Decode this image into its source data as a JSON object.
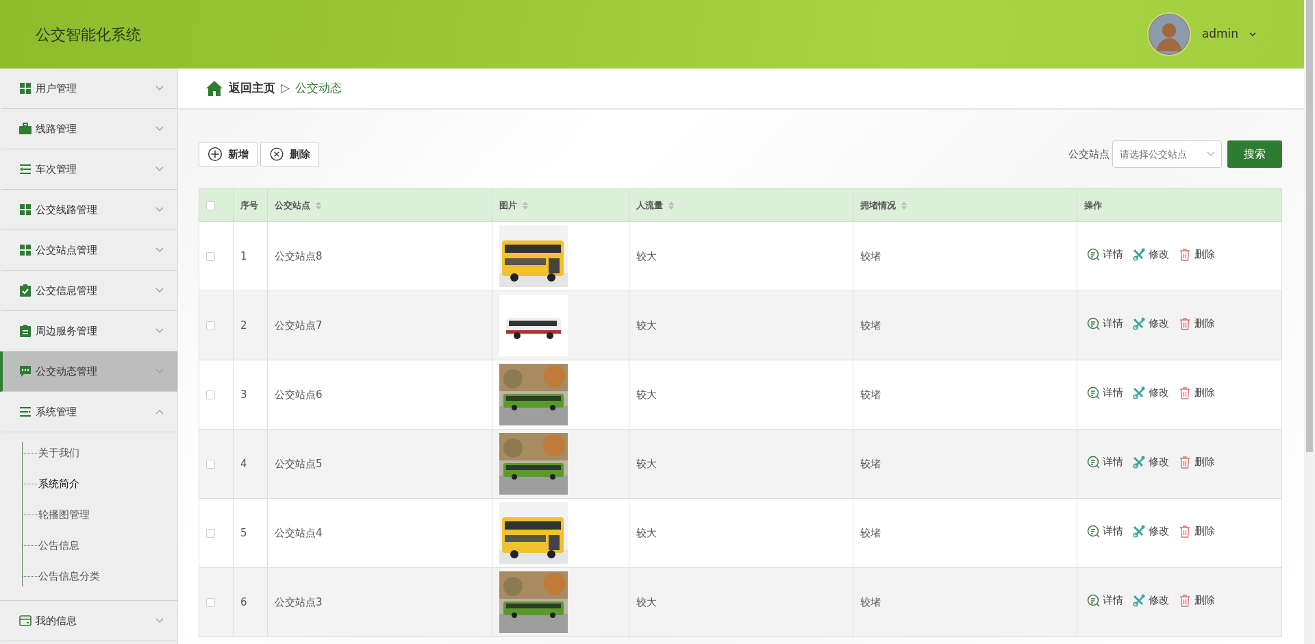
{
  "app_title": "公交智能化系统",
  "user": {
    "name": "admin"
  },
  "sidebar": {
    "items": [
      {
        "label": "用户管理",
        "selected": false,
        "expanded": false
      },
      {
        "label": "线路管理",
        "selected": false,
        "expanded": false
      },
      {
        "label": "车次管理",
        "selected": false,
        "expanded": false
      },
      {
        "label": "公交线路管理",
        "selected": false,
        "expanded": false
      },
      {
        "label": "公交站点管理",
        "selected": false,
        "expanded": false
      },
      {
        "label": "公交信息管理",
        "selected": false,
        "expanded": false
      },
      {
        "label": "周边服务管理",
        "selected": false,
        "expanded": false
      },
      {
        "label": "公交动态管理",
        "selected": true,
        "expanded": false
      },
      {
        "label": "系统管理",
        "selected": false,
        "expanded": true,
        "children": [
          {
            "label": "关于我们",
            "selected": false
          },
          {
            "label": "系统简介",
            "selected": true
          },
          {
            "label": "轮播图管理",
            "selected": false
          },
          {
            "label": "公告信息",
            "selected": false
          },
          {
            "label": "公告信息分类",
            "selected": false
          }
        ]
      },
      {
        "label": "我的信息",
        "selected": false,
        "expanded": false
      }
    ]
  },
  "breadcrumb": {
    "home": "返回主页",
    "separator": "▷",
    "current": "公交动态"
  },
  "toolbar": {
    "buttons": [
      "新增",
      "删除"
    ],
    "filter_label": "公交站点",
    "filter": {
      "placeholder": "请选择公交站点"
    },
    "search_button": "搜索"
  },
  "table": {
    "select_all_checked": false,
    "columns": [
      {
        "label": "序号",
        "sortable": false
      },
      {
        "label": "公交站点",
        "sortable": true
      },
      {
        "label": "图片",
        "sortable": true
      },
      {
        "label": "人流量",
        "sortable": true
      },
      {
        "label": "拥堵情况",
        "sortable": true
      },
      {
        "label": "操作",
        "sortable": false
      }
    ],
    "rows": [
      {
        "checked": false,
        "no": "1",
        "station": "公交站点8",
        "flow": "较大",
        "congestion": "较堵",
        "actions": [
          "详情",
          "修改",
          "删除"
        ]
      },
      {
        "checked": false,
        "no": "2",
        "station": "公交站点7",
        "flow": "较大",
        "congestion": "较堵",
        "actions": [
          "详情",
          "修改",
          "删除"
        ]
      },
      {
        "checked": false,
        "no": "3",
        "station": "公交站点6",
        "flow": "较大",
        "congestion": "较堵",
        "actions": [
          "详情",
          "修改",
          "删除"
        ]
      },
      {
        "checked": false,
        "no": "4",
        "station": "公交站点5",
        "flow": "较大",
        "congestion": "较堵",
        "actions": [
          "详情",
          "修改",
          "删除"
        ]
      },
      {
        "checked": false,
        "no": "5",
        "station": "公交站点4",
        "flow": "较大",
        "congestion": "较堵",
        "actions": [
          "详情",
          "修改",
          "删除"
        ]
      },
      {
        "checked": false,
        "no": "6",
        "station": "公交站点3",
        "flow": "较大",
        "congestion": "较堵",
        "actions": [
          "详情",
          "修改",
          "删除"
        ]
      }
    ]
  }
}
